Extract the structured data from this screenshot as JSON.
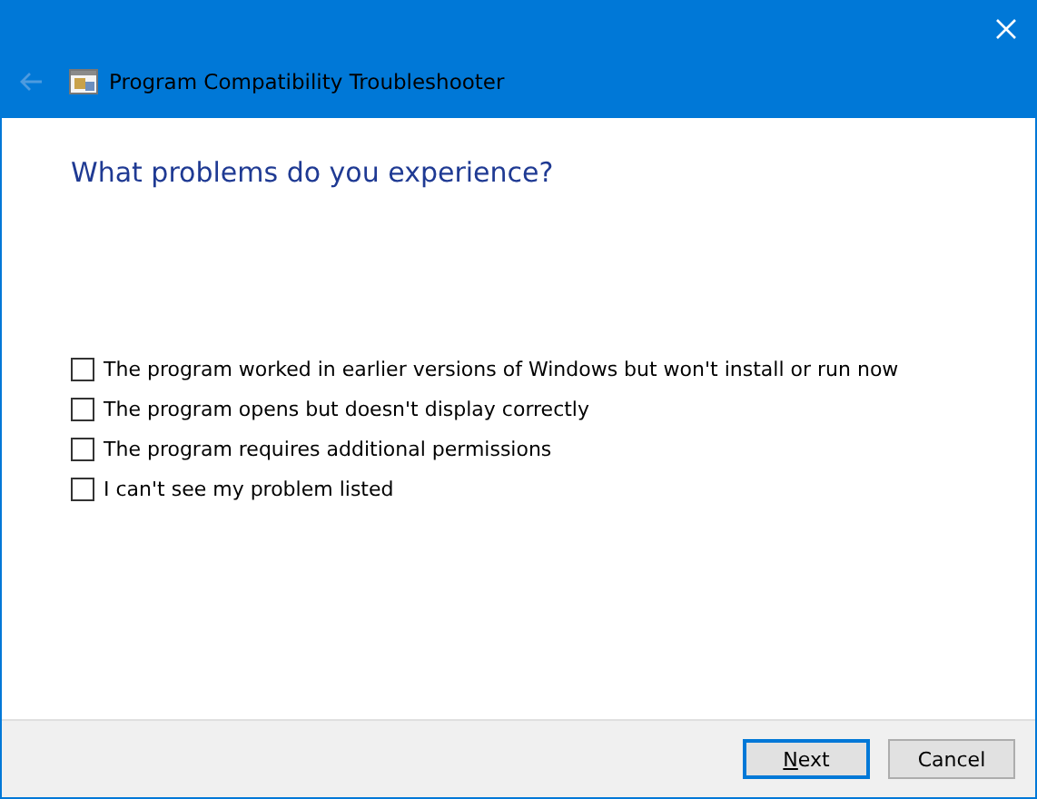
{
  "window": {
    "title": "Program Compatibility Troubleshooter",
    "back_enabled": false
  },
  "heading": "What problems do you experience?",
  "options": [
    {
      "label": "The program worked in earlier versions of Windows but won't install or run now",
      "checked": false
    },
    {
      "label": "The program opens but doesn't display correctly",
      "checked": false
    },
    {
      "label": "The program requires additional permissions",
      "checked": false
    },
    {
      "label": "I can't see my problem listed",
      "checked": false
    }
  ],
  "buttons": [
    {
      "label": "Next",
      "default": true,
      "mnemonic_first": true
    },
    {
      "label": "Cancel",
      "default": false,
      "mnemonic_first": false
    }
  ]
}
